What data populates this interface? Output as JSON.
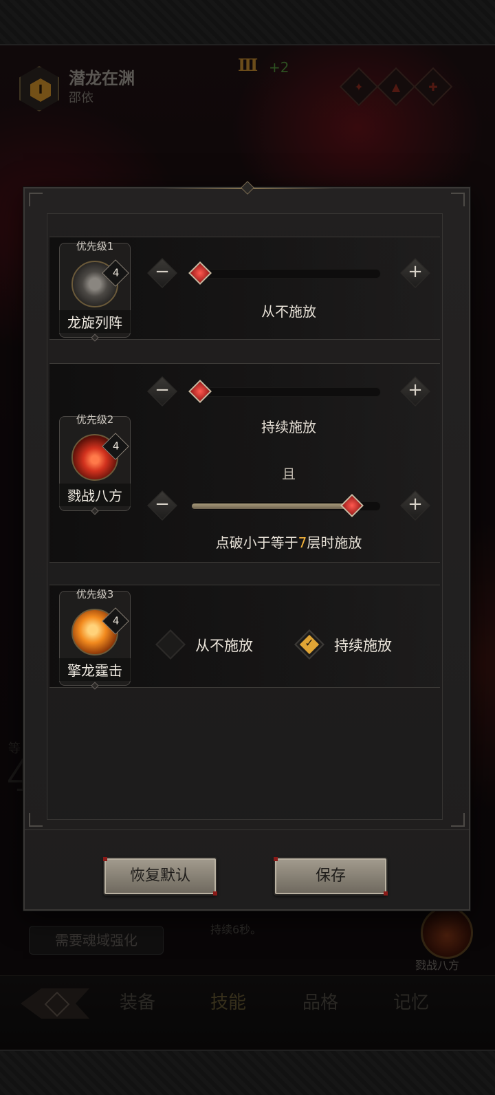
{
  "background": {
    "character": {
      "badge_level": "I",
      "title": "潜龙在渊",
      "subtitle": "邵依",
      "rank": "Ⅲ",
      "rank_bonus": "+2"
    },
    "need_button": "需要魂域强化",
    "desc_snippet": "持续6秒。",
    "big_number": "420",
    "side_skill_name": "戮战八方",
    "tabs": [
      {
        "label": "装备",
        "active": false
      },
      {
        "label": "技能",
        "active": true
      },
      {
        "label": "品格",
        "active": false
      },
      {
        "label": "记忆",
        "active": false
      }
    ]
  },
  "modal": {
    "rows": [
      {
        "priority": "优先级1",
        "skill_name": "龙旋列阵",
        "level": "4",
        "icon": "whirlwind-skill-icon",
        "sliders": [
          {
            "value_fraction": 0.0,
            "caption": "从不施放"
          }
        ]
      },
      {
        "priority": "优先级2",
        "skill_name": "戮战八方",
        "level": "4",
        "icon": "explosion-skill-icon",
        "sliders": [
          {
            "value_fraction": 0.0,
            "caption": "持续施放"
          },
          {
            "value_fraction": 0.9,
            "caption_prefix": "点破小于等于",
            "caption_value": "7",
            "caption_suffix": "层时施放"
          }
        ],
        "conjunction": "且"
      },
      {
        "priority": "优先级3",
        "skill_name": "擎龙霆击",
        "level": "4",
        "icon": "fire-dragon-skill-icon",
        "options": [
          {
            "label": "从不施放",
            "checked": false
          },
          {
            "label": "持续施放",
            "checked": true
          }
        ]
      }
    ],
    "buttons": {
      "reset": "恢复默认",
      "save": "保存"
    },
    "minus_symbol": "−",
    "plus_symbol": "+"
  },
  "colors": {
    "accent_gold": "#f0b03a",
    "knob_red": "#d8302a",
    "check_gold": "#e0a535"
  }
}
